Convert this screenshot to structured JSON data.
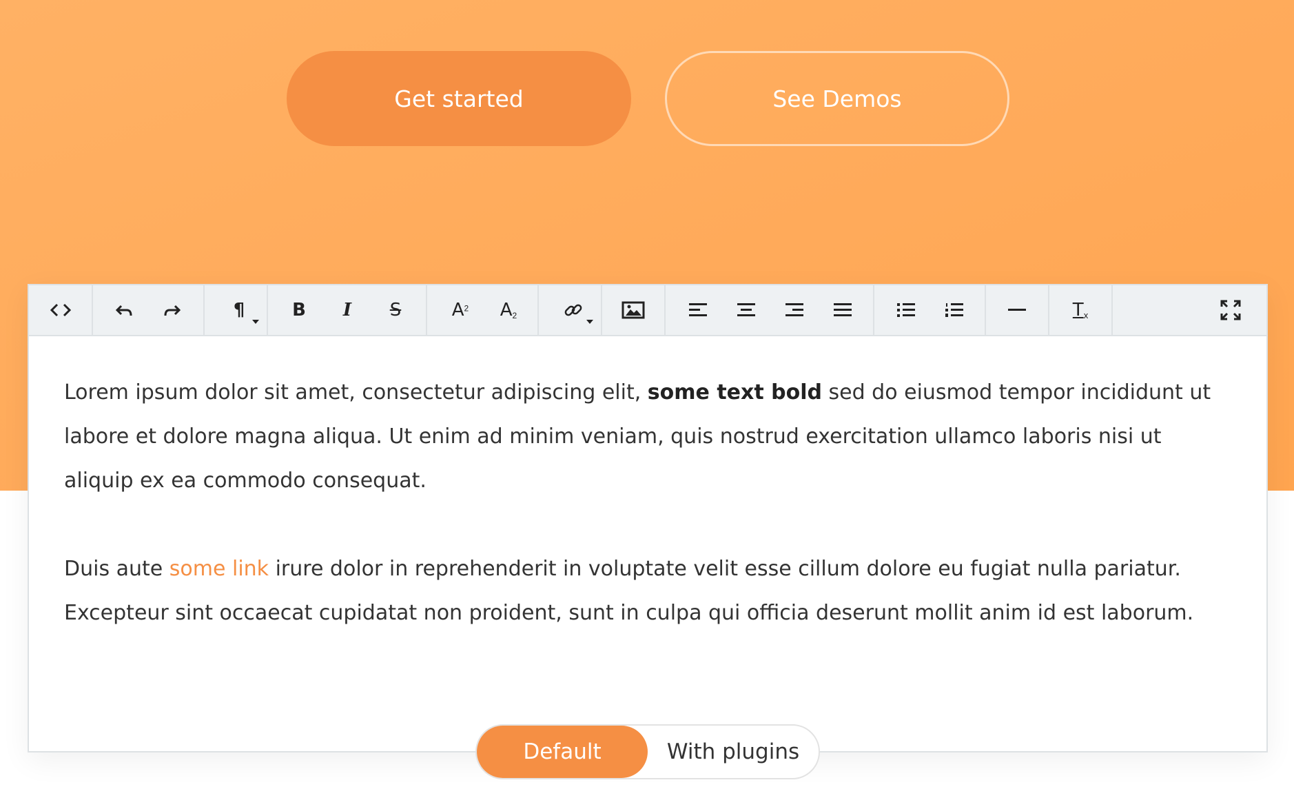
{
  "hero": {
    "primary_cta": "Get started",
    "secondary_cta": "See Demos"
  },
  "colors": {
    "accent": "#f58f44",
    "hero_background": "#ffab5c",
    "toolbar_background": "#eef1f3"
  },
  "toolbar": {
    "buttons": [
      {
        "name": "html-view",
        "icon": "code-icon"
      },
      {
        "name": "undo",
        "icon": "undo-icon"
      },
      {
        "name": "redo",
        "icon": "redo-icon"
      },
      {
        "name": "paragraph-format",
        "icon": "paragraph-icon"
      },
      {
        "name": "bold",
        "icon": "bold-icon",
        "label": "B"
      },
      {
        "name": "italic",
        "icon": "italic-icon",
        "label": "I"
      },
      {
        "name": "strikethrough",
        "icon": "strikethrough-icon",
        "label": "S"
      },
      {
        "name": "superscript",
        "icon": "superscript-icon",
        "label": "A",
        "sub": "2"
      },
      {
        "name": "subscript",
        "icon": "subscript-icon",
        "label": "A",
        "sub": "2"
      },
      {
        "name": "insert-link",
        "icon": "link-icon"
      },
      {
        "name": "insert-image",
        "icon": "image-icon"
      },
      {
        "name": "align-left",
        "icon": "align-left-icon"
      },
      {
        "name": "align-center",
        "icon": "align-center-icon"
      },
      {
        "name": "align-right",
        "icon": "align-right-icon"
      },
      {
        "name": "align-justify",
        "icon": "align-justify-icon"
      },
      {
        "name": "unordered-list",
        "icon": "bullet-list-icon"
      },
      {
        "name": "ordered-list",
        "icon": "numbered-list-icon"
      },
      {
        "name": "horizontal-line",
        "icon": "horizontal-rule-icon"
      },
      {
        "name": "clear-formatting",
        "icon": "clear-format-icon",
        "label": "T",
        "sub": "x"
      },
      {
        "name": "fullscreen",
        "icon": "fullscreen-icon"
      }
    ]
  },
  "content": {
    "p1_before": "Lorem ipsum dolor sit amet, consectetur adipiscing elit, ",
    "p1_bold": "some text bold",
    "p1_after": " sed do eiusmod tempor incididunt ut labore et dolore magna aliqua. Ut enim ad minim veniam, quis nostrud exercitation ullamco laboris nisi ut aliquip ex ea commodo consequat.",
    "p2_before": "Duis aute ",
    "p2_link": "some link",
    "p2_after": " irure dolor in reprehenderit in voluptate velit esse cillum dolore eu fugiat nulla pariatur. Excepteur sint occaecat cupidatat non proident, sunt in culpa qui officia deserunt mollit anim id est laborum."
  },
  "switch": {
    "active": "Default",
    "inactive": "With plugins"
  }
}
